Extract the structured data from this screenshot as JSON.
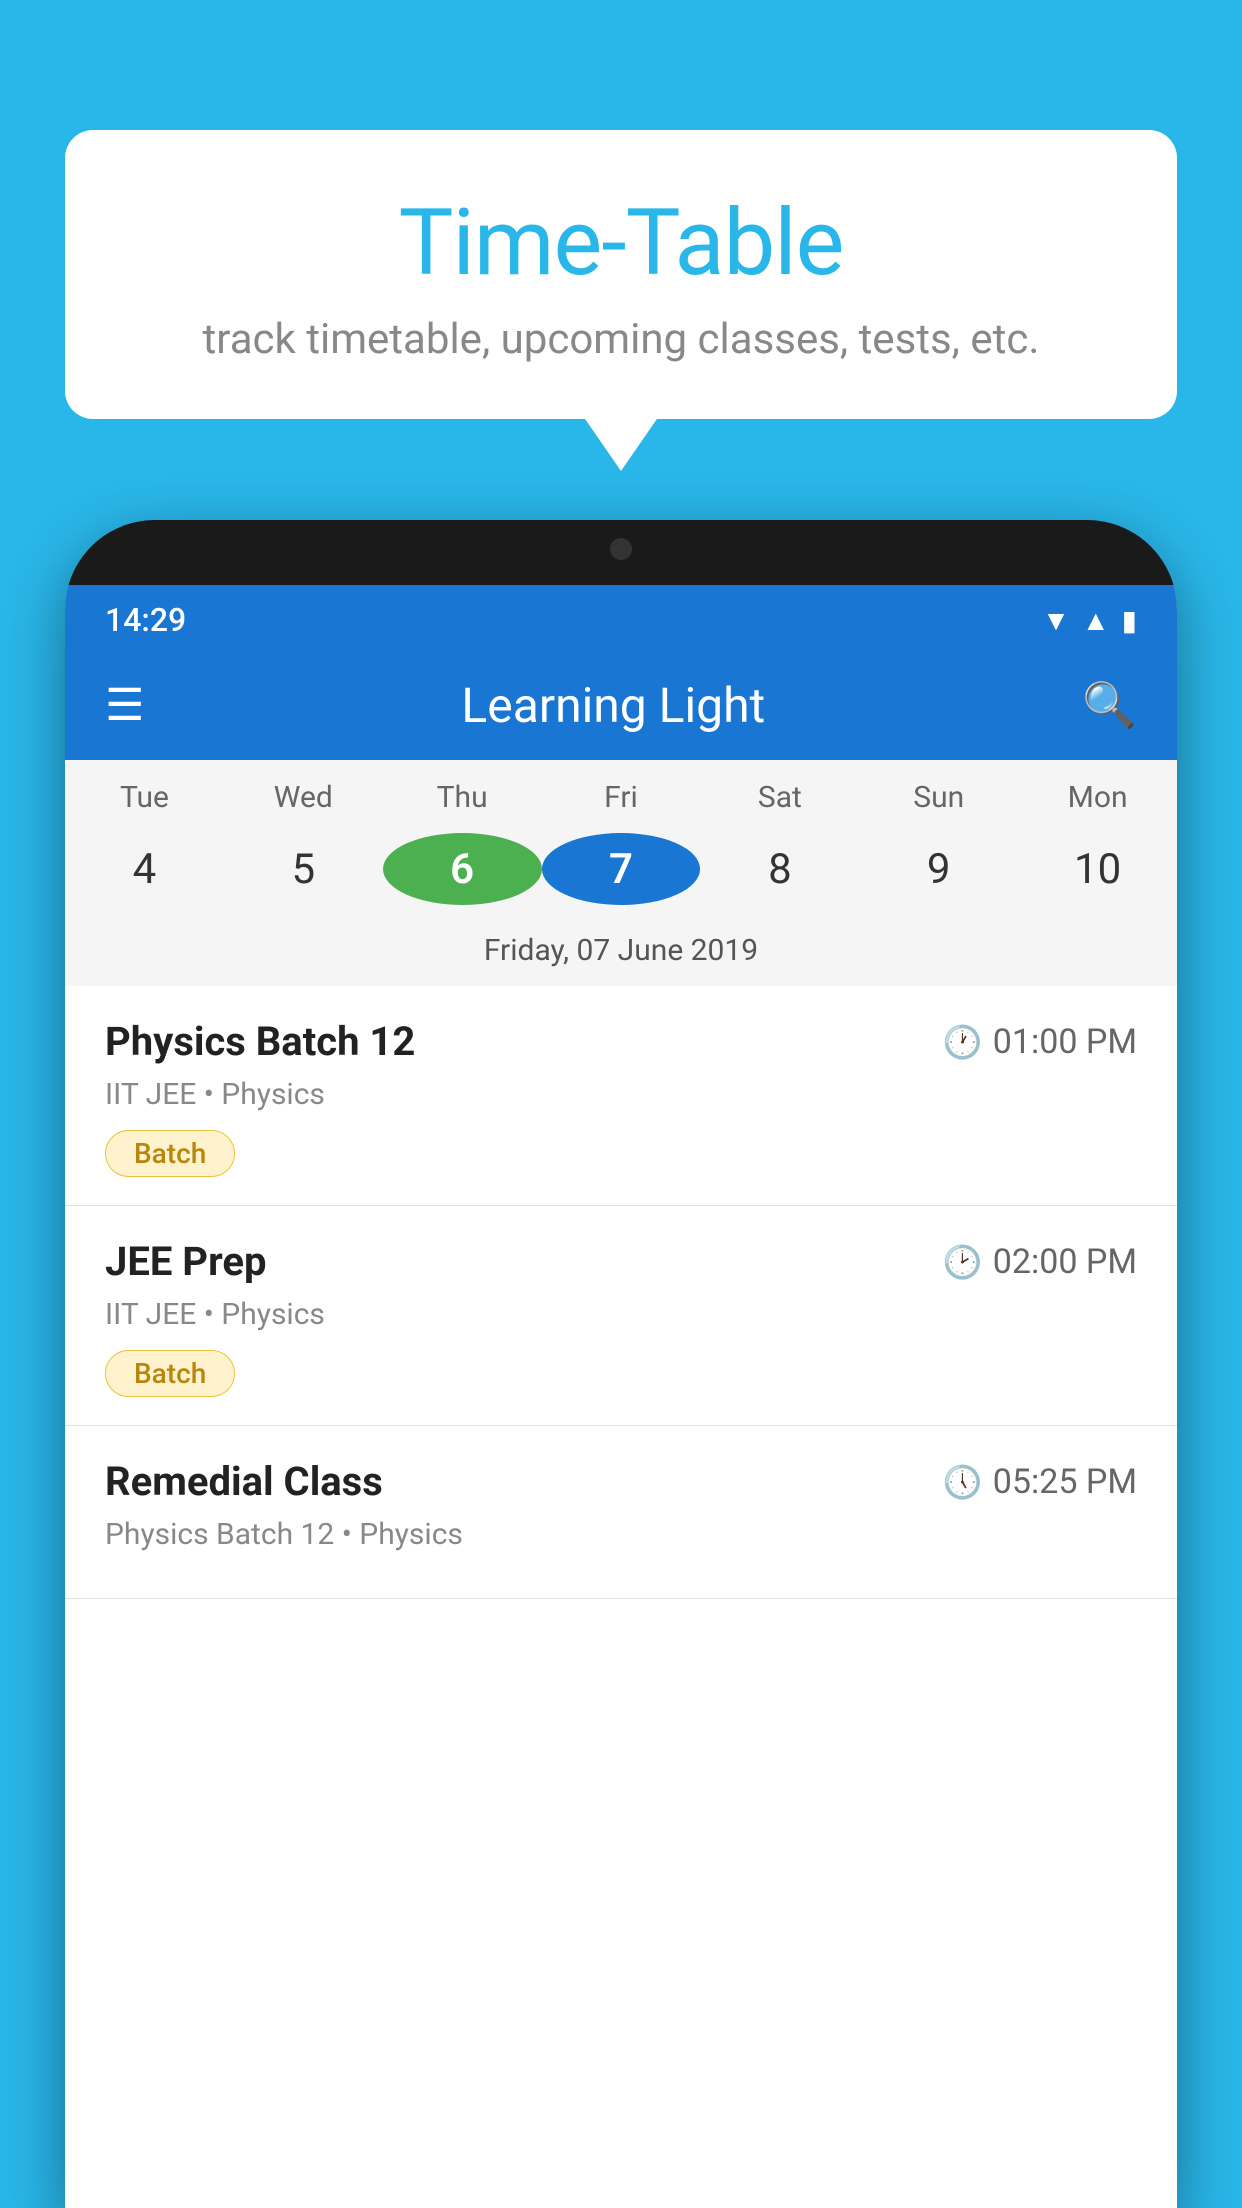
{
  "background_color": "#29b6e8",
  "bubble": {
    "title": "Time-Table",
    "subtitle": "track timetable, upcoming classes, tests, etc."
  },
  "phone": {
    "status_bar": {
      "time": "14:29"
    },
    "app_bar": {
      "title": "Learning Light"
    },
    "calendar": {
      "days": [
        {
          "label": "Tue",
          "number": "4"
        },
        {
          "label": "Wed",
          "number": "5"
        },
        {
          "label": "Thu",
          "number": "6",
          "state": "today"
        },
        {
          "label": "Fri",
          "number": "7",
          "state": "selected"
        },
        {
          "label": "Sat",
          "number": "8"
        },
        {
          "label": "Sun",
          "number": "9"
        },
        {
          "label": "Mon",
          "number": "10"
        }
      ],
      "selected_date_label": "Friday, 07 June 2019"
    },
    "schedule": [
      {
        "title": "Physics Batch 12",
        "time": "01:00 PM",
        "subtitle": "IIT JEE • Physics",
        "badge": "Batch"
      },
      {
        "title": "JEE Prep",
        "time": "02:00 PM",
        "subtitle": "IIT JEE • Physics",
        "badge": "Batch"
      },
      {
        "title": "Remedial Class",
        "time": "05:25 PM",
        "subtitle": "Physics Batch 12 • Physics",
        "badge": null
      }
    ]
  }
}
